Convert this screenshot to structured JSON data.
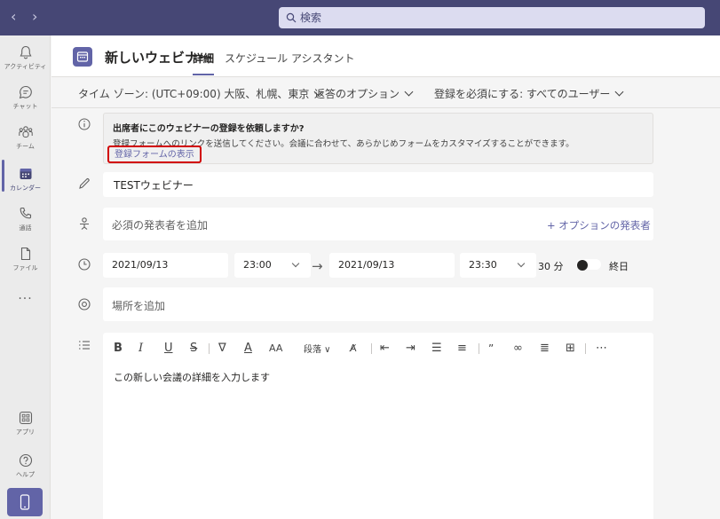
{
  "topbar": {
    "back_icon": "chevron-left-icon",
    "forward_icon": "chevron-right-icon",
    "search_placeholder": "検索"
  },
  "rail": {
    "items": [
      {
        "label": "アクティビティ",
        "icon": "bell-icon"
      },
      {
        "label": "チャット",
        "icon": "chat-icon"
      },
      {
        "label": "チーム",
        "icon": "teams-icon"
      },
      {
        "label": "カレンダー",
        "icon": "calendar-icon",
        "active": true
      },
      {
        "label": "通話",
        "icon": "phone-icon"
      },
      {
        "label": "ファイル",
        "icon": "file-icon"
      }
    ],
    "more": "...",
    "bottom_items": [
      {
        "label": "アプリ",
        "icon": "apps-icon"
      },
      {
        "label": "ヘルプ",
        "icon": "help-icon"
      }
    ]
  },
  "header": {
    "title": "新しいウェビナー",
    "tabs": [
      {
        "label": "詳細",
        "active": true
      },
      {
        "label": "スケジュール アシスタント",
        "active": false
      }
    ]
  },
  "options": {
    "timezone": "タイム ゾーン: (UTC+09:00) 大阪、札幌、東京",
    "response": "返答のオプション",
    "registration": "登録を必須にする: すべてのユーザー"
  },
  "notice": {
    "title": "出席者にこのウェビナーの登録を依頼しますか?",
    "body": "登録フォームへのリンクを送信してください。会議に合わせて、あらかじめフォームをカスタマイズすることができます。",
    "link": "登録フォームの表示"
  },
  "form": {
    "title_value": "TESTウェビナー",
    "presenter_placeholder": "必須の発表者を追加",
    "optional_presenter": "+ オプションの発表者",
    "start_date": "2021/09/13",
    "start_time": "23:00",
    "end_date": "2021/09/13",
    "end_time": "23:30",
    "duration": "30 分",
    "all_day_label": "終日",
    "all_day": false,
    "location_placeholder": "場所を追加"
  },
  "editor": {
    "paragraph_label": "段落",
    "placeholder": "この新しい会議の詳細を入力します"
  },
  "colors": {
    "topbar": "#464775",
    "accent": "#6264a7",
    "highlight_border": "#d10000"
  }
}
